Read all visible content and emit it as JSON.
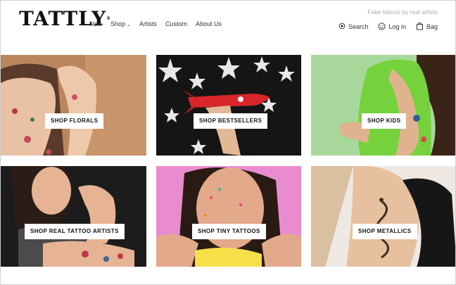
{
  "brand": {
    "logo": "TATTLY",
    "tm": "®",
    "tagline": "Fake tattoos by real artists"
  },
  "nav": {
    "new": "New",
    "shop": "Shop",
    "artists": "Artists",
    "custom": "Custom",
    "about": "About Us"
  },
  "util": {
    "search": "Search",
    "login": "Log in",
    "bag": "Bag"
  },
  "tiles": [
    {
      "label": "SHOP FLORALS",
      "icon": "arm-florals"
    },
    {
      "label": "SHOP BESTSELLERS",
      "icon": "rocket-stars"
    },
    {
      "label": "SHOP KIDS",
      "icon": "kid-arm"
    },
    {
      "label": "SHOP REAL TATTOO ARTISTS",
      "icon": "woman-flex"
    },
    {
      "label": "SHOP TINY TATTOOS",
      "icon": "woman-face"
    },
    {
      "label": "SHOP METALLICS",
      "icon": "snake-arm"
    }
  ],
  "colors": {
    "florals_bg": "#c8946a",
    "bestsellers_bg": "#151515",
    "kids_bg": "#a8d79c",
    "artists_bg": "#1c1c1c",
    "tiny_bg": "#e98ccf",
    "metallics_bg": "#efe8e2"
  }
}
